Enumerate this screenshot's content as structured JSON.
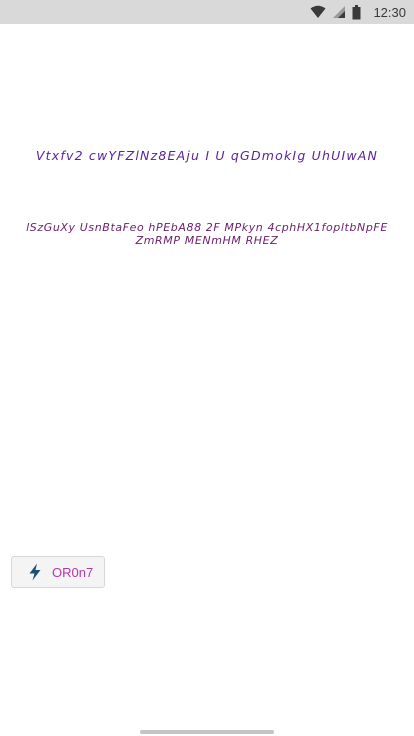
{
  "status_bar": {
    "time": "12:30",
    "icons": [
      "wifi-icon",
      "cellular-signal-icon",
      "battery-icon"
    ]
  },
  "content": {
    "title": "Vtxfv2 cwYFZlNz8EAju I  U qGDmokIg UhUIwAN",
    "subtitle_lines": [
      "lSzGuXy UsnBtaFeo hPEbA88 2F MPkyn 4cphHX1fopltbNpFE",
      "ZmRMP MENmHM RHEZ"
    ]
  },
  "action_button": {
    "label": "OR0n7",
    "icon": "lightning-bolt-icon"
  },
  "colors": {
    "title": "#5b1f9a",
    "subtitle": "#6b1f6b",
    "button_label": "#b23aa8",
    "bolt_icon": "#1f4f78",
    "status_bar_bg": "#d9d9d9"
  }
}
